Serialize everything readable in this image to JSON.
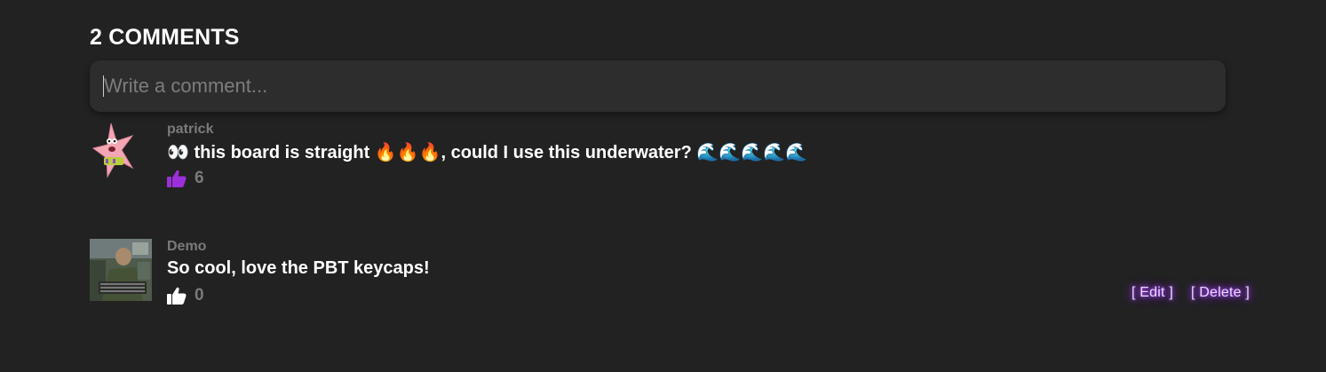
{
  "comments_section": {
    "heading": "2 COMMENTS",
    "input": {
      "placeholder": "Write a comment...",
      "value": ""
    },
    "accent_color": "#9b30d9",
    "comments": [
      {
        "author": "patrick",
        "avatar": "patrick-star-avatar",
        "text": "👀 this board is straight 🔥🔥🔥, could I use this underwater? 🌊🌊🌊🌊🌊",
        "likes": "6",
        "liked": true
      },
      {
        "author": "Demo",
        "avatar": "photo-avatar",
        "text": "So cool, love the PBT keycaps!",
        "likes": "0",
        "liked": false,
        "edit_label": "[ Edit ]",
        "delete_label": "[ Delete ]"
      }
    ]
  }
}
